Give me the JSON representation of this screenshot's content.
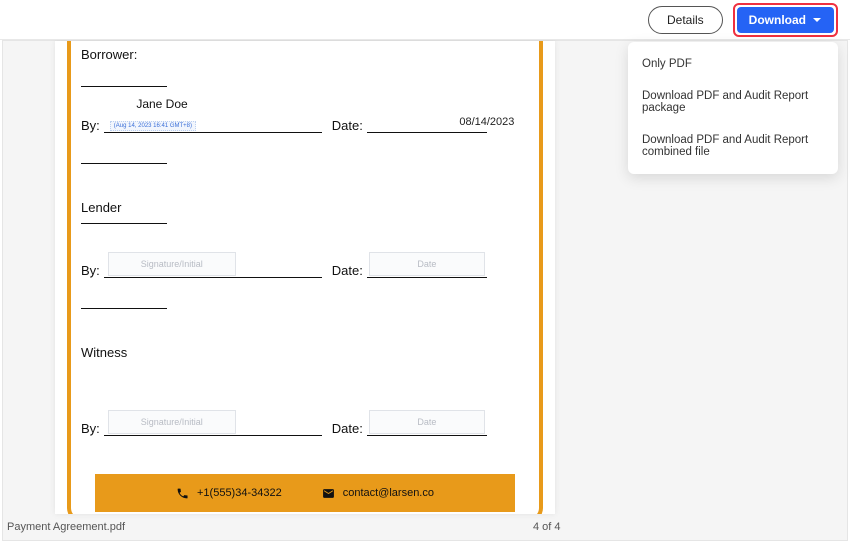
{
  "toolbar": {
    "details_label": "Details",
    "download_label": "Download"
  },
  "download_menu": {
    "items": [
      "Only PDF",
      "Download PDF and Audit Report package",
      "Download PDF and Audit Report combined file"
    ]
  },
  "document": {
    "filename": "Payment Agreement.pdf",
    "page_indicator": "4 of 4",
    "sections": {
      "borrower": {
        "label": "Borrower:",
        "printed_name": "Jane Doe",
        "by_label": "By:",
        "sig_stamp": "(Aug 14, 2023 16:41 GMT+8)",
        "date_label": "Date:",
        "date_value": "08/14/2023"
      },
      "lender": {
        "label": "Lender",
        "by_label": "By:",
        "sig_placeholder": "Signature/Initial",
        "date_label": "Date:",
        "date_placeholder": "Date"
      },
      "witness": {
        "label": "Witness",
        "by_label": "By:",
        "sig_placeholder": "Signature/Initial",
        "date_label": "Date:",
        "date_placeholder": "Date"
      }
    },
    "footer": {
      "phone": "+1(555)34-34322",
      "email": "contact@larsen.co"
    }
  }
}
